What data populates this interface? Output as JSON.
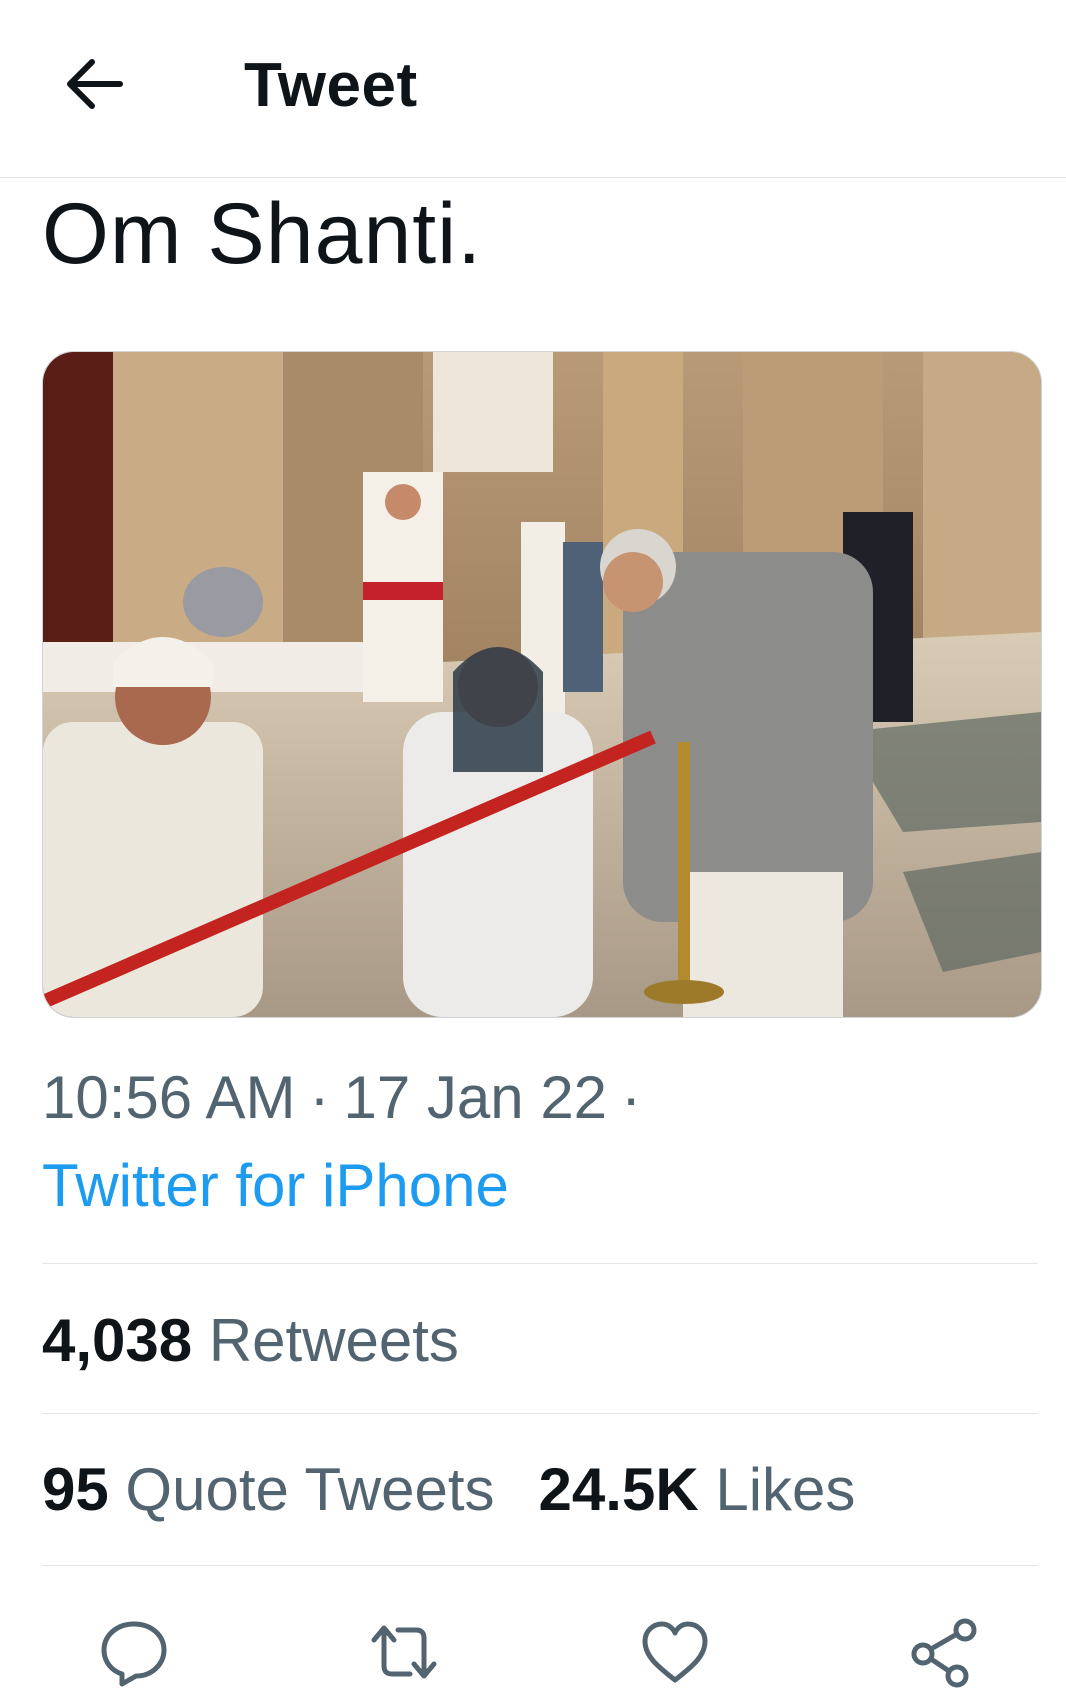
{
  "header": {
    "back_icon": "arrow-left-icon",
    "title": "Tweet"
  },
  "tweet": {
    "text": "Om Shanti.",
    "media_alt": "photo",
    "time": "10:56 AM",
    "date": "17 Jan 22",
    "separator": "·",
    "source": "Twitter for iPhone"
  },
  "stats": {
    "retweets_count": "4,038",
    "retweets_label": "Retweets",
    "quotes_count": "95",
    "quotes_label": "Quote Tweets",
    "likes_count": "24.5K",
    "likes_label": "Likes"
  },
  "actions": {
    "reply_icon": "reply-icon",
    "retweet_icon": "retweet-icon",
    "like_icon": "heart-icon",
    "share_icon": "share-icon"
  },
  "colors": {
    "link_blue": "#1d9bf0",
    "secondary_text": "#536471",
    "primary_text": "#0f1419",
    "divider": "#e1e5e8"
  }
}
